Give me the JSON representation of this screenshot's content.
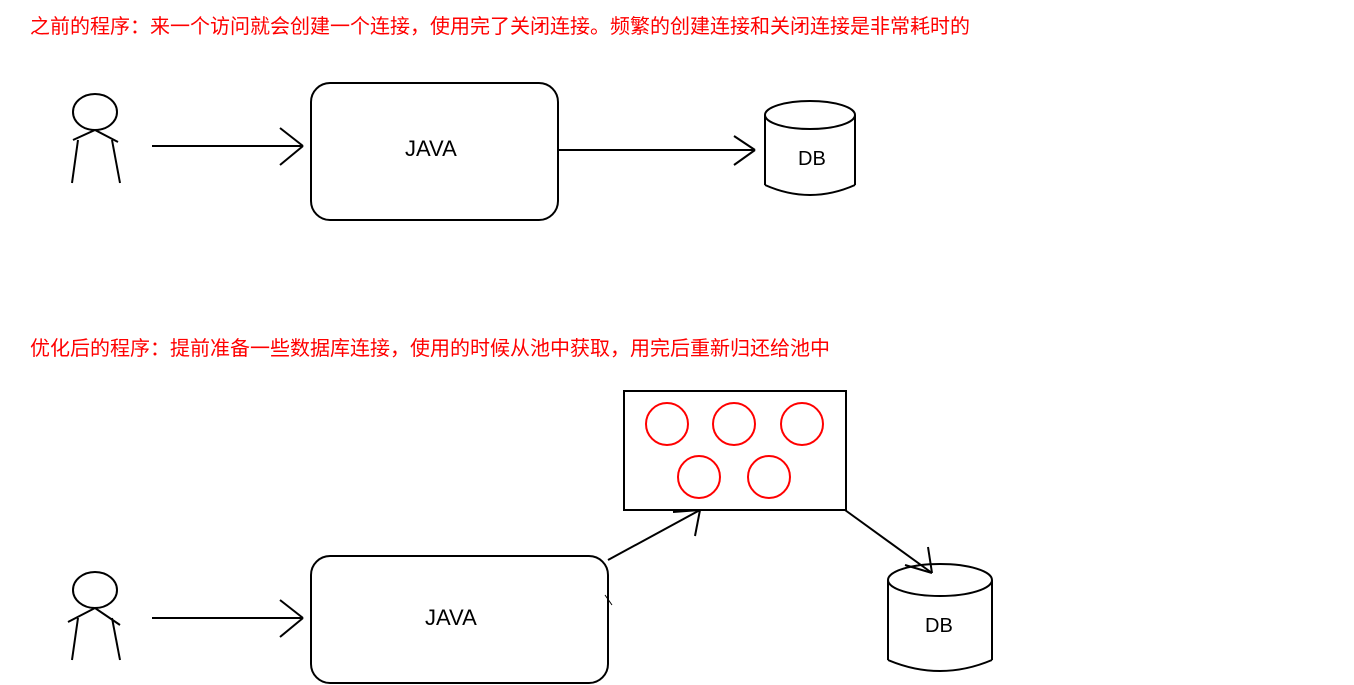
{
  "diagram1": {
    "caption_prefix": "之前的程序：",
    "caption_text": "来一个访问就会创建一个连接，使用完了关闭连接。频繁的创建连接和关闭连接是非常耗时的",
    "java_label": "JAVA",
    "db_label": "DB"
  },
  "diagram2": {
    "caption_prefix": "优化后的程序：",
    "caption_text": "提前准备一些数据库连接，使用的时候从池中获取，用完后重新归还给池中",
    "java_label": "JAVA",
    "db_label": "DB",
    "pool_connection_count": 5
  }
}
